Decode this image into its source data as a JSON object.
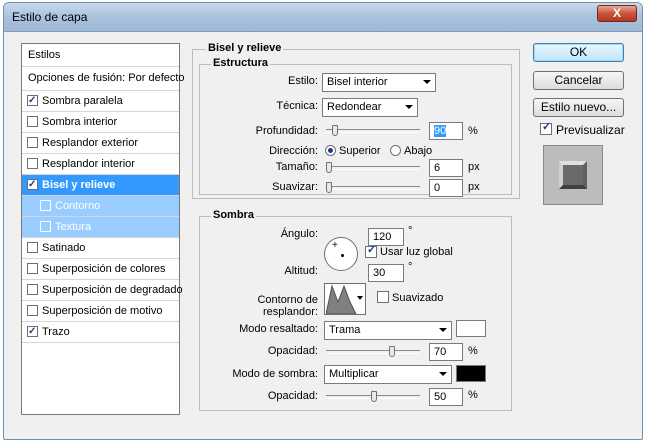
{
  "window": {
    "title": "Estilo de capa",
    "close_label": "X"
  },
  "styles_list": {
    "header": "Estilos",
    "blending": "Opciones de fusión: Por defecto",
    "items": [
      {
        "label": "Sombra paralela",
        "checked": true
      },
      {
        "label": "Sombra interior",
        "checked": false
      },
      {
        "label": "Resplandor exterior",
        "checked": false
      },
      {
        "label": "Resplandor interior",
        "checked": false
      },
      {
        "label": "Bisel y relieve",
        "checked": true
      },
      {
        "label": "Contorno",
        "checked": false
      },
      {
        "label": "Textura",
        "checked": false
      },
      {
        "label": "Satinado",
        "checked": false
      },
      {
        "label": "Superposición de colores",
        "checked": false
      },
      {
        "label": "Superposición de degradado",
        "checked": false
      },
      {
        "label": "Superposición de motivo",
        "checked": false
      },
      {
        "label": "Trazo",
        "checked": true
      }
    ]
  },
  "bevel": {
    "title": "Bisel y relieve",
    "structure_title": "Estructura",
    "style_label": "Estilo:",
    "style_value": "Bisel interior",
    "technique_label": "Técnica:",
    "technique_value": "Redondear",
    "depth_label": "Profundidad:",
    "depth_value": "90",
    "depth_unit": "%",
    "direction_label": "Dirección:",
    "direction_up": "Superior",
    "direction_down": "Abajo",
    "size_label": "Tamaño:",
    "size_value": "6",
    "size_unit": "px",
    "soften_label": "Suavizar:",
    "soften_value": "0",
    "soften_unit": "px"
  },
  "shading": {
    "title": "Sombra",
    "angle_label": "Ángulo:",
    "angle_value": "120",
    "angle_unit": "°",
    "global_light_label": "Usar luz global",
    "altitude_label": "Altitud:",
    "altitude_value": "30",
    "altitude_unit": "°",
    "gloss_contour_label": "Contorno de resplandor:",
    "antialiased_label": "Suavizado",
    "highlight_mode_label": "Modo resaltado:",
    "highlight_mode_value": "Trama",
    "highlight_color": "#ffffff",
    "opacity_label": "Opacidad:",
    "highlight_opacity": "70",
    "opacity_unit": "%",
    "shadow_mode_label": "Modo de sombra:",
    "shadow_mode_value": "Multiplicar",
    "shadow_color": "#000000",
    "shadow_opacity_label": "Opacidad:",
    "shadow_opacity": "50"
  },
  "buttons": {
    "ok": "OK",
    "cancel": "Cancelar",
    "new_style": "Estilo nuevo...",
    "preview_label": "Previsualizar"
  }
}
